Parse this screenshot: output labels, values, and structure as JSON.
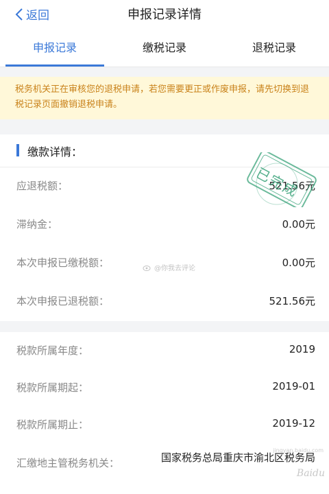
{
  "header": {
    "back_label": "返回",
    "title": "申报记录详情"
  },
  "tabs": [
    {
      "label": "申报记录",
      "active": true
    },
    {
      "label": "缴税记录",
      "active": false
    },
    {
      "label": "退税记录",
      "active": false
    }
  ],
  "notice": {
    "text": "税务机关正在审核您的退税申请，若您需要更正或作废申报，请先切换到退税记录页面撤销退税申请。"
  },
  "section": {
    "title": "缴款详情："
  },
  "payment_rows": [
    {
      "label": "应退税额：",
      "value": "521.56元"
    },
    {
      "label": "滞纳金：",
      "value": "0.00元"
    },
    {
      "label": "本次申报已缴税额：",
      "value": "0.00元"
    },
    {
      "label": "本次申报已退税额：",
      "value": "521.56元"
    }
  ],
  "period_rows": [
    {
      "label": "税款所属年度：",
      "value": "2019"
    },
    {
      "label": "税款所属期起：",
      "value": "2019-01"
    },
    {
      "label": "税款所属期止：",
      "value": "2019-12"
    },
    {
      "label": "汇缴地主管税务机关：",
      "value": "国家税务总局重庆市渝北区税务局"
    }
  ],
  "stamp": {
    "text": "已完成",
    "color": "#3aa37a"
  },
  "watermark": {
    "text": "@你我去评论",
    "corner_text": "Baidu",
    "corner_sub": "jingyan.baidu.com"
  },
  "colors": {
    "accent": "#3a78d8",
    "notice_bg": "#fff8d9",
    "notice_text": "#c9821a"
  }
}
